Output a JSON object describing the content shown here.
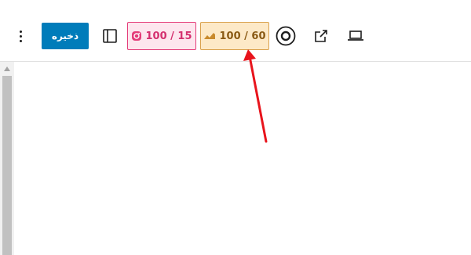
{
  "toolbar": {
    "save_label": "ذخیره",
    "pink_badge": {
      "value": "100 / 15",
      "icon": "instagram-icon",
      "color": "#e43c79"
    },
    "orange_badge": {
      "value": "100 / 60",
      "icon": "speed-icon",
      "color": "#d9a14c"
    },
    "icons": [
      "more-vertical-icon",
      "sidebar-panel-icon",
      "circle-dot-icon",
      "external-link-icon",
      "laptop-icon"
    ]
  },
  "annotation": {
    "arrow_color": "#e8141c"
  },
  "colors": {
    "save_button": "#007cba"
  }
}
